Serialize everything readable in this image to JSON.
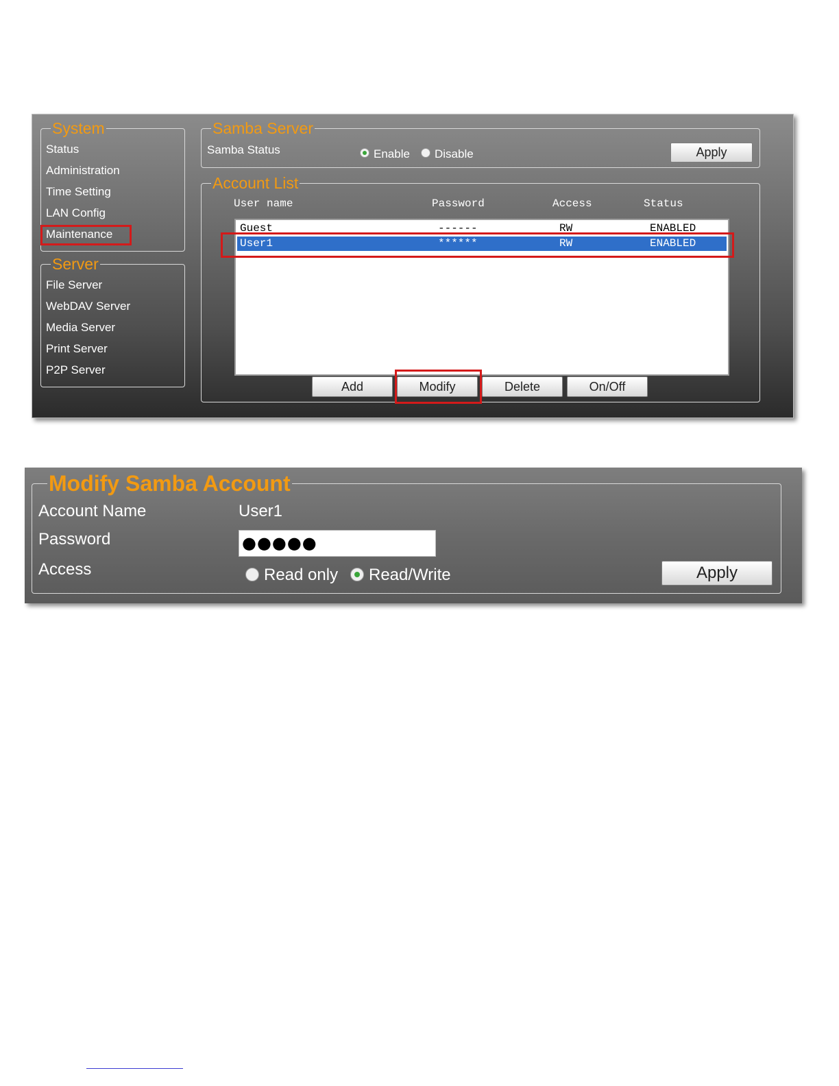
{
  "sidebar": {
    "system_title": "System",
    "system_items": [
      "Status",
      "Administration",
      "Time Setting",
      "LAN Config",
      "Maintenance"
    ],
    "server_title": "Server",
    "server_items": [
      "File Server",
      "WebDAV Server",
      "Media Server",
      "Print Server",
      "P2P Server"
    ]
  },
  "samba_server": {
    "title": "Samba Server",
    "status_label": "Samba Status",
    "enable_label": "Enable",
    "disable_label": "Disable",
    "selected": "Enable",
    "apply_label": "Apply"
  },
  "account_list": {
    "title": "Account List",
    "columns": [
      "User name",
      "Password",
      "Access",
      "Status"
    ],
    "rows": [
      {
        "user": "Guest",
        "password": "------",
        "access": "RW",
        "status": "ENABLED",
        "selected": false
      },
      {
        "user": "User1",
        "password": "******",
        "access": "RW",
        "status": "ENABLED",
        "selected": true
      }
    ],
    "buttons": [
      "Add",
      "Modify",
      "Delete",
      "On/Off"
    ]
  },
  "modify_account": {
    "title": "Modify Samba Account",
    "account_name_label": "Account Name",
    "account_name_value": "User1",
    "password_label": "Password",
    "password_value": "●●●●●",
    "access_label": "Access",
    "read_only_label": "Read only",
    "read_write_label": "Read/Write",
    "selected_access": "Read/Write",
    "apply_label": "Apply"
  },
  "colors": {
    "accent_orange": "#f29a12",
    "highlight_red": "#d41a1a",
    "selection_blue": "#2f6fc9"
  }
}
